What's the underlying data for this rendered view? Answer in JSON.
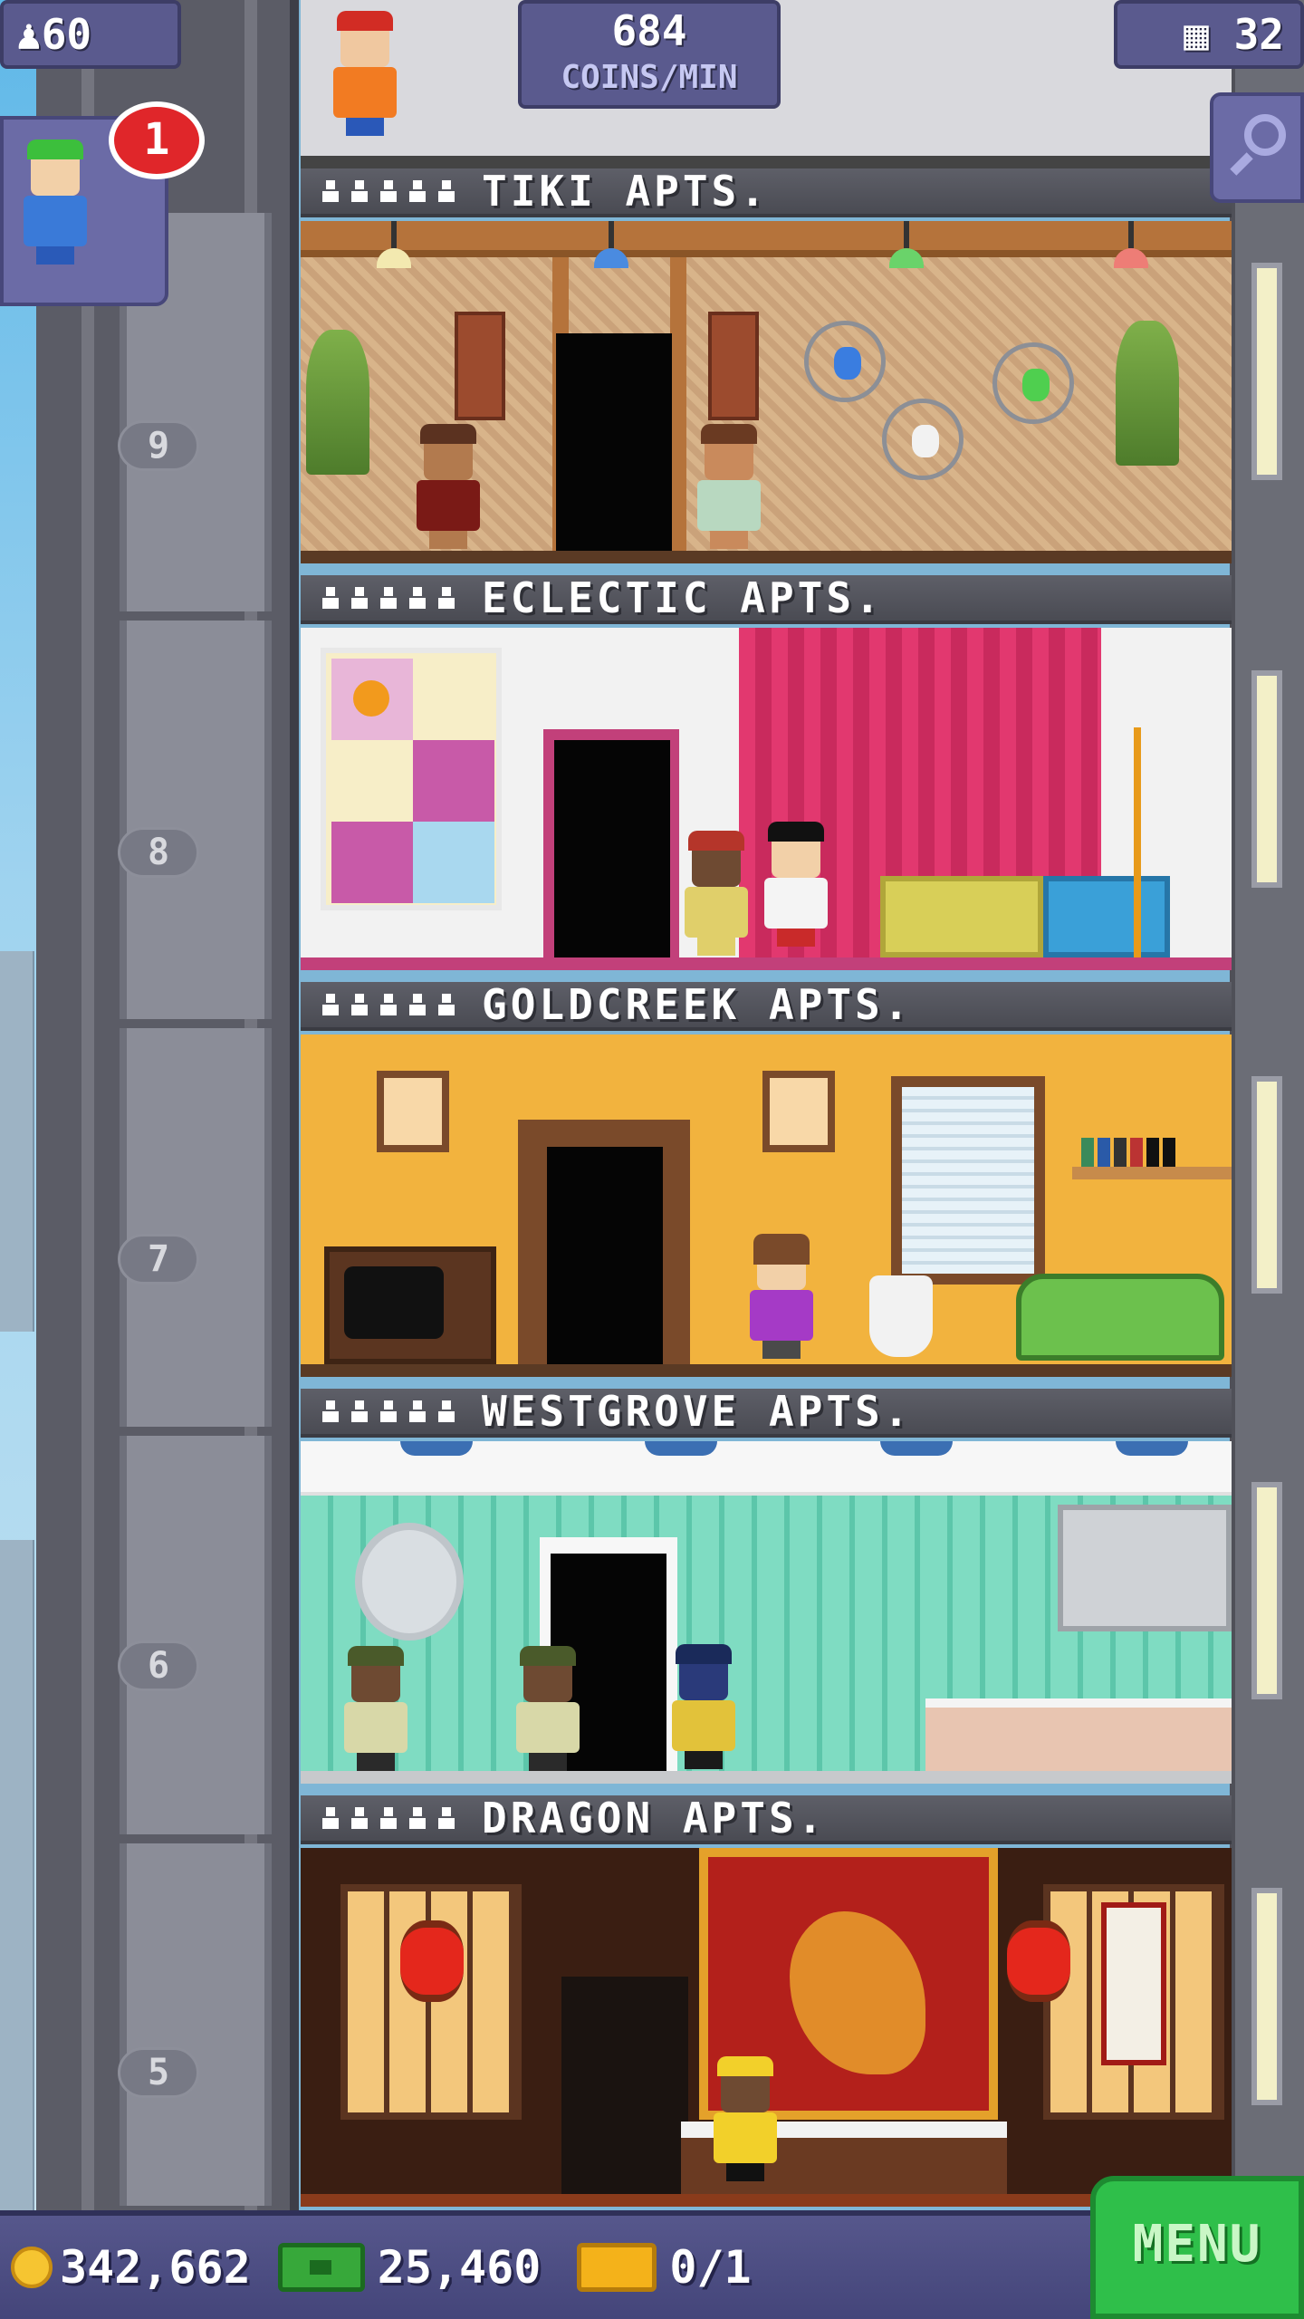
{
  "hud": {
    "population": "60",
    "coins_per_min_value": "684",
    "coins_per_min_label": "COINS/MIN",
    "floor_count": "32",
    "mission_badge": "1"
  },
  "floors": [
    {
      "number": "9",
      "name": "TIKI APTS."
    },
    {
      "number": "8",
      "name": "ECLECTIC APTS."
    },
    {
      "number": "7",
      "name": "GOLDCREEK APTS."
    },
    {
      "number": "6",
      "name": "WESTGROVE APTS."
    },
    {
      "number": "5",
      "name": "DRAGON APTS."
    }
  ],
  "bottom_bar": {
    "coins": "342,662",
    "bux": "25,460",
    "tickets": "0/1",
    "menu_label": "MENU"
  },
  "colors": {
    "hud_panel": "#5a5a8e",
    "menu_green": "#2fbf4a",
    "badge_red": "#e0262a"
  },
  "icons": [
    "population-icon",
    "floors-icon",
    "zoom-icon",
    "coin-icon",
    "bux-icon",
    "ticket-icon",
    "resident-icon"
  ]
}
